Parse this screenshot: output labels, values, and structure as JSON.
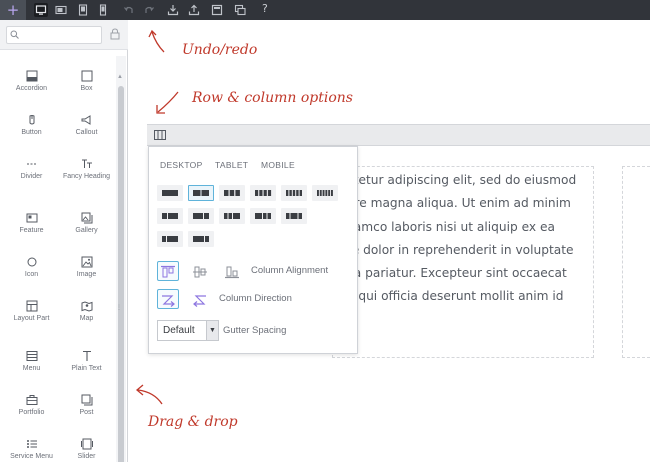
{
  "toolbar": {
    "add_icon": "plus-icon",
    "buttons": [
      {
        "name": "desktop-view",
        "icon": "monitor-icon",
        "active": true
      },
      {
        "name": "tablet-landscape-view",
        "icon": "tablet-landscape-icon"
      },
      {
        "name": "tablet-portrait-view",
        "icon": "tablet-portrait-icon"
      },
      {
        "name": "mobile-view",
        "icon": "mobile-icon"
      },
      {
        "name": "undo",
        "icon": "undo-icon"
      },
      {
        "name": "redo",
        "icon": "redo-icon"
      },
      {
        "name": "import",
        "icon": "import-icon"
      },
      {
        "name": "export",
        "icon": "export-icon"
      },
      {
        "name": "layouts",
        "icon": "layout-icon"
      },
      {
        "name": "duplicate",
        "icon": "duplicate-icon"
      }
    ],
    "help_label": "?"
  },
  "sidebar": {
    "search": {
      "value": "",
      "placeholder": ""
    },
    "widgets": [
      {
        "label": "Accordion",
        "icon": "accordion-icon"
      },
      {
        "label": "Box",
        "icon": "box-icon"
      },
      {
        "label": "Button",
        "icon": "button-icon"
      },
      {
        "label": "Callout",
        "icon": "callout-icon"
      },
      {
        "label": "Divider",
        "icon": "divider-icon"
      },
      {
        "label": "Fancy Heading",
        "icon": "fancy-heading-icon"
      },
      {
        "label": "Feature",
        "icon": "feature-icon"
      },
      {
        "label": "Gallery",
        "icon": "gallery-icon"
      },
      {
        "label": "Icon",
        "icon": "icon-widget-icon"
      },
      {
        "label": "Image",
        "icon": "image-icon"
      },
      {
        "label": "Layout Part",
        "icon": "layout-part-icon"
      },
      {
        "label": "Map",
        "icon": "map-icon"
      },
      {
        "label": "Menu",
        "icon": "menu-icon"
      },
      {
        "label": "Plain Text",
        "icon": "plain-text-icon"
      },
      {
        "label": "Portfolio",
        "icon": "portfolio-icon"
      },
      {
        "label": "Post",
        "icon": "post-icon"
      },
      {
        "label": "Service Menu",
        "icon": "service-menu-icon"
      },
      {
        "label": "Slider",
        "icon": "slider-icon"
      }
    ]
  },
  "annotations": {
    "undo_redo": "Undo/redo",
    "row_column": "Row & column options",
    "drag_drop": "Drag & drop"
  },
  "popup": {
    "tabs": [
      "DESKTOP",
      "TABLET",
      "MOBILE"
    ],
    "column_alignment_label": "Column Alignment",
    "column_direction_label": "Column Direction",
    "gutter_value": "Default",
    "gutter_label": "Gutter Spacing"
  },
  "content": {
    "lines": [
      "ctetur adipiscing elit, sed do eiusmod",
      "ore magna aliqua. Ut enim ad minim",
      "llamco laboris nisi ut aliquip ex ea",
      "re dolor in reprehenderit in voluptate",
      "lla pariatur. Excepteur sint occaecat",
      "a qui officia deserunt mollit anim id"
    ]
  },
  "colors": {
    "toolbar_bg": "#31343a",
    "accent_blue": "#5fb3da",
    "annotation_red": "#c0392b",
    "purple": "#8d76e0"
  }
}
